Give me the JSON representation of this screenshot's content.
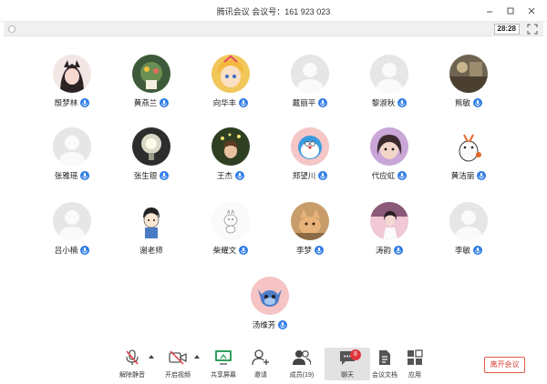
{
  "window": {
    "title": "腾讯会议 会议号：161 923 023",
    "controls": [
      "minimize-icon",
      "maximize-icon",
      "close-icon"
    ]
  },
  "subbar": {
    "timer": "28:28"
  },
  "participants": [
    {
      "name": "殷梦林"
    },
    {
      "name": "黄燕兰"
    },
    {
      "name": "向华丰"
    },
    {
      "name": "戴丽平"
    },
    {
      "name": "黎淑秋"
    },
    {
      "name": "熊敏"
    },
    {
      "name": "张雅瑶"
    },
    {
      "name": "张生银"
    },
    {
      "name": "王杰"
    },
    {
      "name": "郑望川"
    },
    {
      "name": "代应虹"
    },
    {
      "name": "黄洁丽"
    },
    {
      "name": "吕小楠"
    },
    {
      "name": "谢老师"
    },
    {
      "name": "柴耀文"
    },
    {
      "name": "李梦"
    },
    {
      "name": "涛韵"
    },
    {
      "name": "李敏"
    },
    {
      "name": "汤维芳"
    }
  ],
  "toolbar": {
    "mute_label": "解除静音",
    "video_label": "开启视频",
    "share_label": "共享屏幕",
    "invite_label": "邀请",
    "members_label": "成员(19)",
    "chat_label": "聊天",
    "chat_badge": "8",
    "docs_label": "会议文档",
    "apps_label": "应用",
    "leave_label": "离开会议"
  },
  "colors": {
    "accent": "#2e7be6",
    "leave": "#d6453a",
    "badge": "#e0353b"
  }
}
